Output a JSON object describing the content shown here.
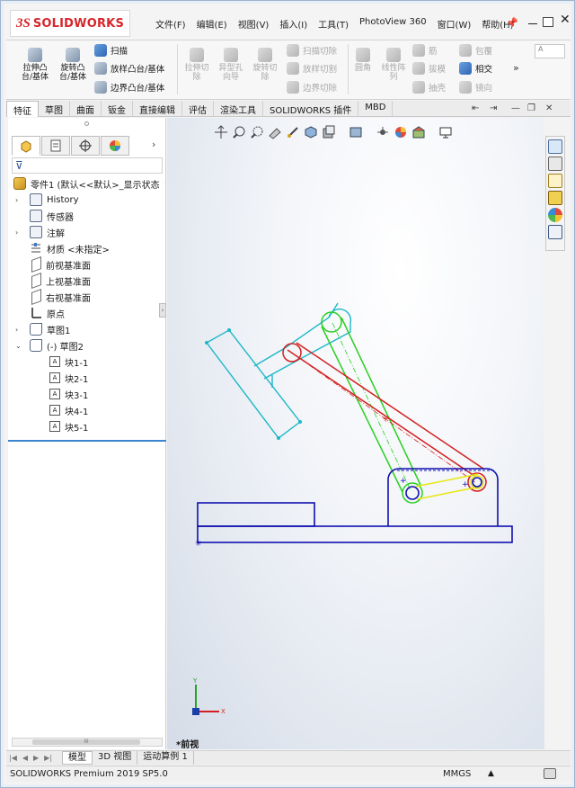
{
  "app": {
    "brand_ds": "3S",
    "brand_name": "SOLIDWORKS",
    "menu": [
      "文件(F)",
      "编辑(E)",
      "视图(V)",
      "插入(I)",
      "工具(T)",
      "PhotoView 360",
      "窗口(W)",
      "帮助(H)"
    ]
  },
  "ribbon": {
    "extrude": "拉伸凸\n台/基体",
    "revolve": "旋转凸\n台/基体",
    "sweep": "扫描",
    "loft": "放样凸台/基体",
    "boundary": "边界凸台/基体",
    "extrude_cut": "拉伸切\n除",
    "hole_wizard": "异型孔\n向导",
    "revolve_cut": "旋转切\n除",
    "sweep_cut": "扫描切除",
    "loft_cut": "放样切割",
    "boundary_cut": "边界切除",
    "fillet": "圆角",
    "linear_pattern": "线性阵\n列",
    "rib": "筋",
    "draft": "拔模",
    "shell": "抽壳",
    "wrap": "包覆",
    "intersect": "相交",
    "mirror": "镜向",
    "more": "»"
  },
  "tabs": [
    "特征",
    "草图",
    "曲面",
    "钣金",
    "直接编辑",
    "评估",
    "渲染工具",
    "SOLIDWORKS 插件",
    "MBD"
  ],
  "feature_tree": {
    "root": "零件1 (默认<<默认>_显示状态 1",
    "items": [
      {
        "label": "History",
        "icon": "history-folder-icon"
      },
      {
        "label": "传感器",
        "icon": "sensor-icon"
      },
      {
        "label": "注解",
        "icon": "annotation-icon"
      },
      {
        "label": "材质 <未指定>",
        "icon": "material-icon"
      },
      {
        "label": "前视基准面",
        "icon": "plane-icon"
      },
      {
        "label": "上视基准面",
        "icon": "plane-icon"
      },
      {
        "label": "右视基准面",
        "icon": "plane-icon"
      },
      {
        "label": "原点",
        "icon": "origin-icon"
      },
      {
        "label": "草图1",
        "icon": "sketch-icon"
      },
      {
        "label": "(-) 草图2",
        "icon": "sketch-icon"
      },
      {
        "label": "块1-1",
        "icon": "block-icon"
      },
      {
        "label": "块2-1",
        "icon": "block-icon"
      },
      {
        "label": "块3-1",
        "icon": "block-icon"
      },
      {
        "label": "块4-1",
        "icon": "block-icon"
      },
      {
        "label": "块5-1",
        "icon": "block-icon"
      }
    ],
    "scroll_thumb": "III"
  },
  "viewport": {
    "view_name": "*前视",
    "axis_x": "X",
    "axis_y": "Y"
  },
  "bottom_tabs": [
    "模型",
    "3D 视图",
    "运动算例 1"
  ],
  "status": {
    "product": "SOLIDWORKS Premium 2019 SP5.0",
    "units": "MMGS",
    "units_arrow": "▲"
  },
  "colors": {
    "brand": "#d6262b",
    "cyan_link": "#1cb8c8",
    "red_link": "#d42020",
    "green_link": "#28d020",
    "yellow_link": "#e8e810",
    "base_blue": "#1010b0",
    "tree_split": "#3a84d0"
  }
}
